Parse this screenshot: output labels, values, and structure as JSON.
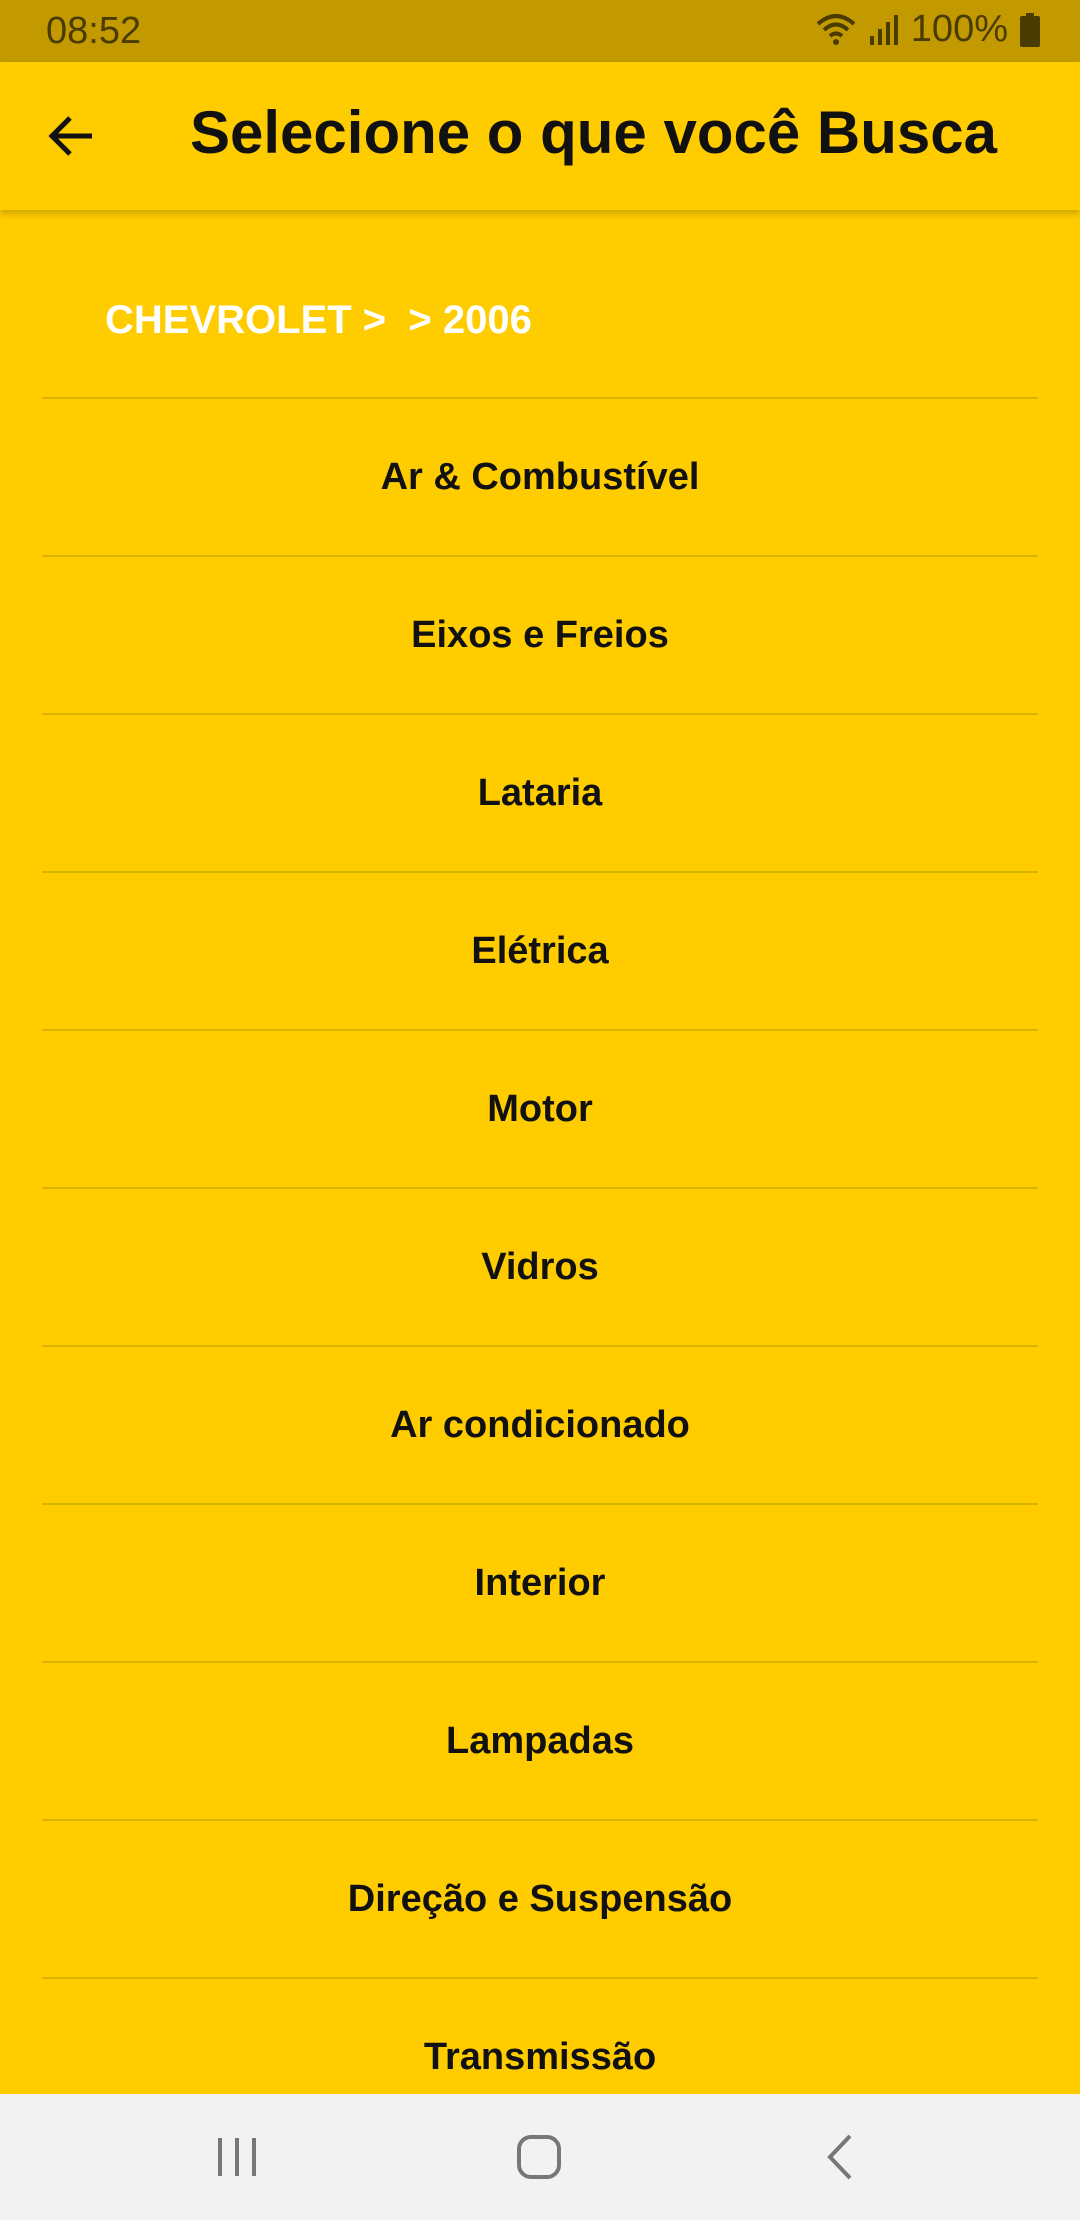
{
  "status_bar": {
    "time": "08:52",
    "battery": "100%",
    "icons": [
      "wifi-icon",
      "signal-icon",
      "battery-icon"
    ]
  },
  "app_bar": {
    "title": "Selecione o que você Busca",
    "back_icon": "arrow-back-icon"
  },
  "breadcrumb": "CHEVROLET >  > 2006",
  "categories": [
    "Ar & Combustível",
    "Eixos e Freios",
    "Lataria",
    "Elétrica",
    "Motor",
    "Vidros",
    "Ar condicionado",
    "Interior",
    "Lampadas",
    "Direção e Suspensão",
    "Transmissão"
  ],
  "colors": {
    "background": "#FFCC00",
    "status_bar": "#C29A00",
    "divider": "#D8B200",
    "breadcrumb_text": "#FFFFFF",
    "nav_bar": "#F2F2F2"
  },
  "nav_bar": {
    "icons": [
      "recents-icon",
      "home-icon",
      "back-icon"
    ]
  }
}
